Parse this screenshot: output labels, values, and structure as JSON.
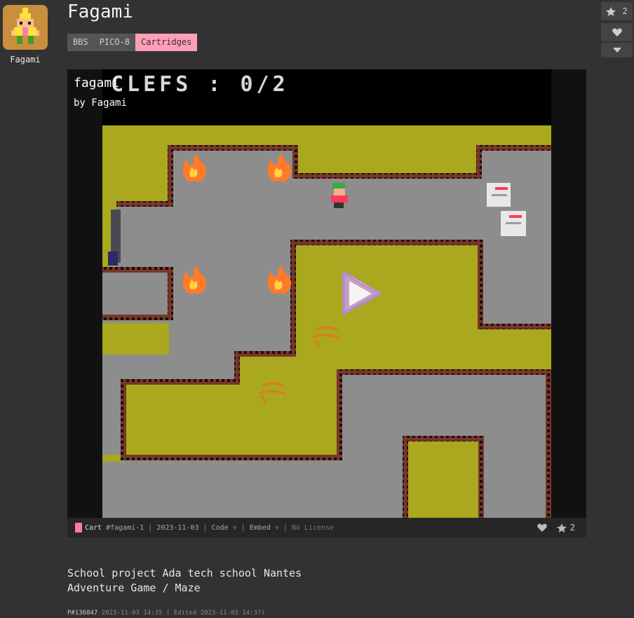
{
  "author": {
    "name": "Fagami"
  },
  "post": {
    "title": "Fagami"
  },
  "breadcrumbs": [
    {
      "label": "BBS"
    },
    {
      "label": "PICO-8"
    },
    {
      "label": "Cartridges"
    }
  ],
  "sidebar": {
    "star_count": "2"
  },
  "cart": {
    "title": "fagami",
    "by_prefix": "by",
    "author": "Fagami",
    "game_hud": "CLEFS : 0/2",
    "label": "Cart",
    "id": "#fagami-1",
    "date": "2023-11-03",
    "code_label": "Code ▿",
    "embed_label": "Embed ▿",
    "license": "No License",
    "star_count": "2"
  },
  "description": {
    "line1": "School project Ada tech school Nantes",
    "line2": "Adventure Game / Maze"
  },
  "meta": {
    "post_id": "P#136847",
    "timestamp": "2023-11-03 14:35 ( Edited 2023-11-03 14:37)"
  },
  "colors": {
    "accent_pink": "#ff9fb7",
    "background": "#323232",
    "floor_gray": "#8d8d8d",
    "grass_yellow": "#a9a81e",
    "wall_brown": "#7a3528"
  },
  "icons": [
    "star-icon",
    "heart-icon",
    "chevron-down-icon",
    "cart-icon",
    "play-icon"
  ]
}
